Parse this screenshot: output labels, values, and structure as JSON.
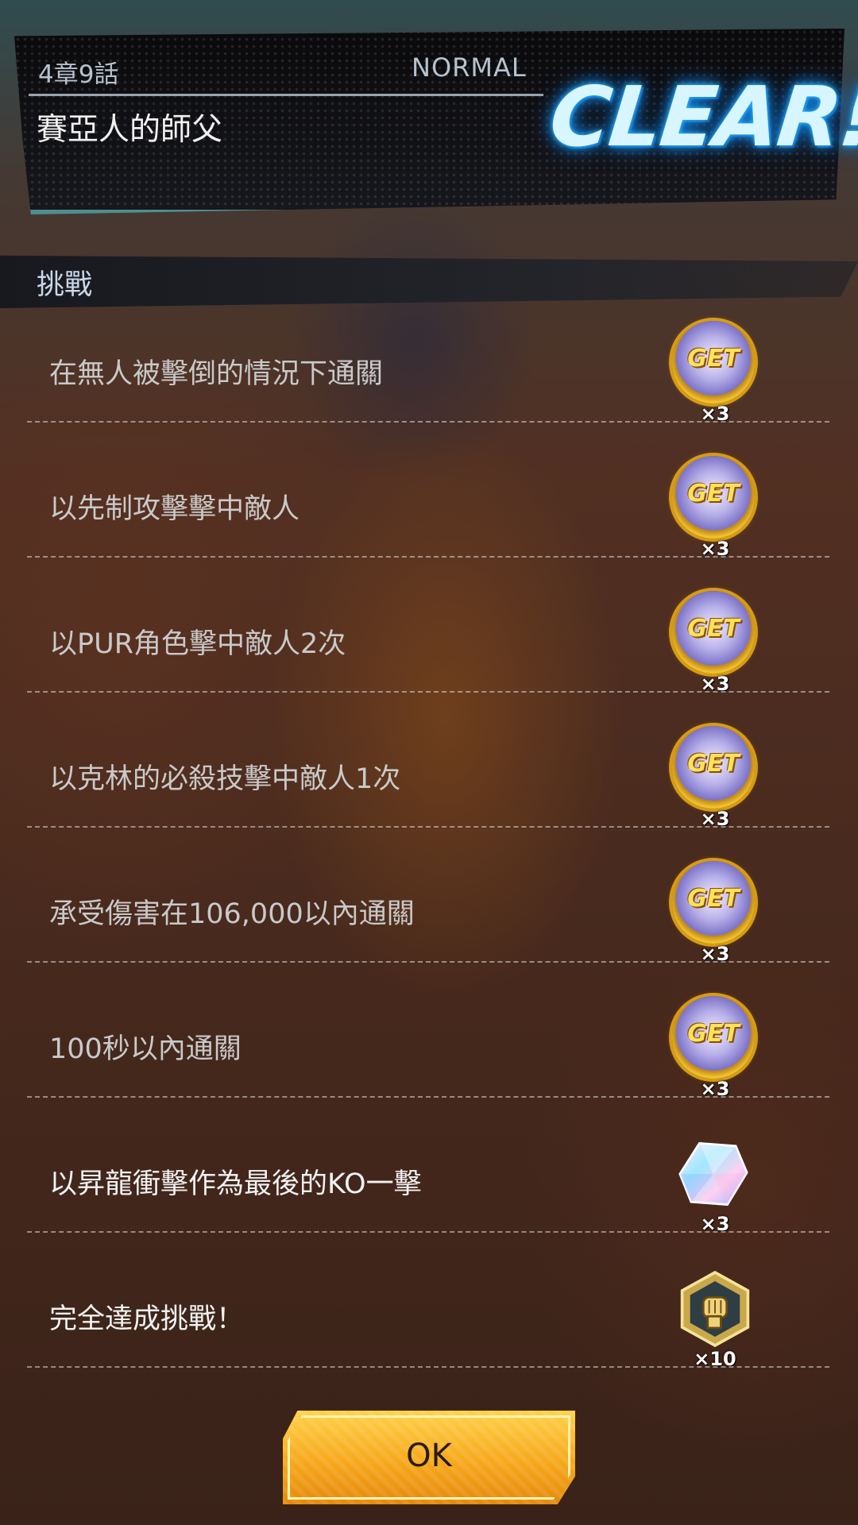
{
  "header": {
    "chapter": "4章9話",
    "difficulty": "NORMAL",
    "stage_title": "賽亞人的師父",
    "clear_text": "CLEAR!"
  },
  "challenges": {
    "section_title": "挑戰",
    "items": [
      {
        "label": "在無人被擊倒的情況下通關",
        "reward_icon": "get-coin-icon",
        "reward_text": "GET",
        "quantity": "×3"
      },
      {
        "label": "以先制攻擊擊中敵人",
        "reward_icon": "get-coin-icon",
        "reward_text": "GET",
        "quantity": "×3"
      },
      {
        "label": "以PUR角色擊中敵人2次",
        "reward_icon": "get-coin-icon",
        "reward_text": "GET",
        "quantity": "×3"
      },
      {
        "label": "以克林的必殺技擊中敵人1次",
        "reward_icon": "get-coin-icon",
        "reward_text": "GET",
        "quantity": "×3"
      },
      {
        "label": "承受傷害在106,000以內通關",
        "reward_icon": "get-coin-icon",
        "reward_text": "GET",
        "quantity": "×3"
      },
      {
        "label": "100秒以內通關",
        "reward_icon": "get-coin-icon",
        "reward_text": "GET",
        "quantity": "×3"
      },
      {
        "label": "以昇龍衝擊作為最後的KO一擊",
        "reward_icon": "chrono-crystal-icon",
        "quantity": "×3"
      },
      {
        "label": "完全達成挑戰！",
        "reward_icon": "fist-medal-icon",
        "quantity": "×10"
      }
    ]
  },
  "ok_button": {
    "label": "OK"
  },
  "colors": {
    "clear_glow": "#38c4ff",
    "ok_button": "#f7a81c",
    "coin_gold": "#f2c531"
  }
}
